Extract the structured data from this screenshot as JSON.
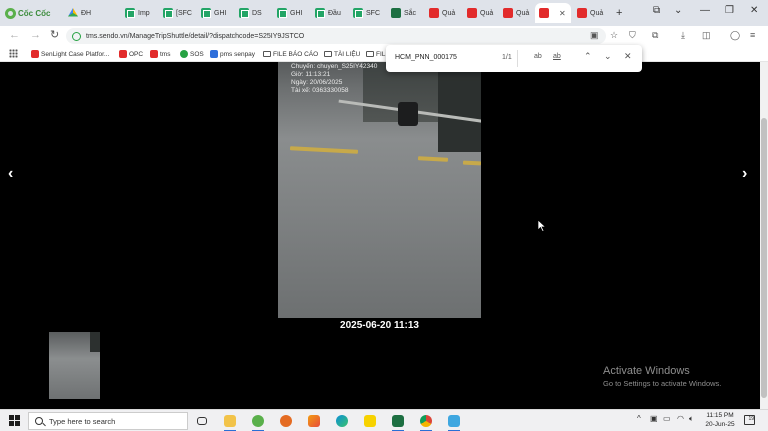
{
  "browser": {
    "brand": "Cốc Cốc",
    "tabs": [
      {
        "label": "ĐH",
        "icon": "google-drive-icon"
      },
      {
        "label": "Imp",
        "icon": "sheets-icon"
      },
      {
        "label": "[SFC",
        "icon": "sheets-icon"
      },
      {
        "label": "GHI",
        "icon": "sheets-icon"
      },
      {
        "label": "DS",
        "icon": "sheets-icon"
      },
      {
        "label": "GHI",
        "icon": "sheets-icon"
      },
      {
        "label": "Đầu",
        "icon": "sheets-icon"
      },
      {
        "label": "SFC",
        "icon": "sheets-icon"
      },
      {
        "label": "Sắc",
        "icon": "excel-icon"
      },
      {
        "label": "Quả",
        "icon": "sendo-icon"
      },
      {
        "label": "Quả",
        "icon": "sendo-icon"
      },
      {
        "label": "Quả",
        "icon": "sendo-icon"
      },
      {
        "label": "",
        "icon": "sendo-icon",
        "active": true
      },
      {
        "label": "Quả",
        "icon": "sendo-icon"
      }
    ],
    "new_tab": "+",
    "url": "tms.sendo.vn/ManageTripShuttle/detail/?dispatchcode=S25IY9JSTCO",
    "bookmarks": [
      {
        "label": "SenLight Case Platfor...",
        "icon": "sendo-icon"
      },
      {
        "label": "OPC",
        "icon": "sendo-icon"
      },
      {
        "label": "tms",
        "icon": "sendo-icon"
      },
      {
        "label": "SOS",
        "icon": "green-circle-icon"
      },
      {
        "label": "pms senpay",
        "icon": "blue-p-icon"
      },
      {
        "label": "FILE BÁO CÁO",
        "icon": "folder-icon"
      },
      {
        "label": "TÀI LIỆU",
        "icon": "folder-icon"
      },
      {
        "label": "FIL",
        "icon": "folder-icon"
      }
    ]
  },
  "find_bar": {
    "query": "HCM_PNN_000175",
    "count": "1/1",
    "match_case": "ab",
    "whole_word": "ab"
  },
  "viewer": {
    "prev": "‹",
    "next": "›",
    "photo_overlay": "Chuyến: chuyen_S25IY42340\nGiờ: 11:13:21\nNgày: 20/06/2025\nTài xế: 0363330058",
    "timestamp": "2025-06-20 11:13"
  },
  "watermark": {
    "title": "Activate Windows",
    "subtitle": "Go to Settings to activate Windows."
  },
  "taskbar": {
    "search_placeholder": "Type here to search",
    "time": "11:15 PM",
    "date": "20-Jun-25",
    "notification_count": "19"
  }
}
